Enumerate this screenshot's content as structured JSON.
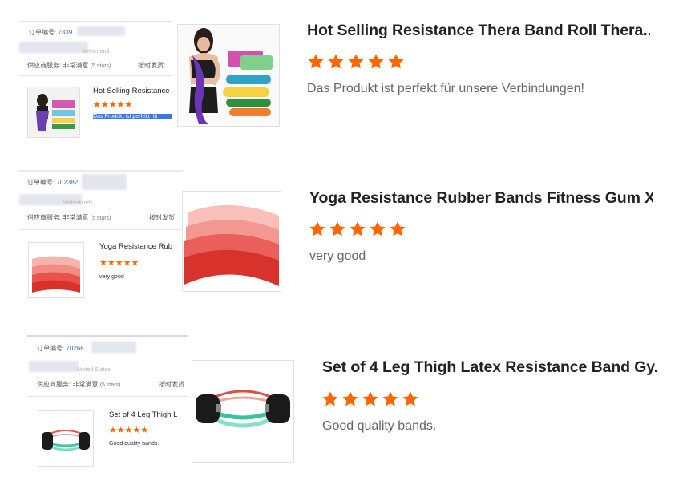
{
  "reviews": [
    {
      "order_label": "订单编号:",
      "order_number_partial": "7339",
      "country": "Netherland",
      "supplier_label": "供应商服务: 非常满意",
      "supplier_stars": "(5 stars)",
      "ontime_label": "按时发货:",
      "mini_title": "Hot Selling Resistance",
      "mini_comment": "Das Produkt ist perfekt für",
      "product_title": "Hot Selling Resistance Thera Band Roll Thera...",
      "rating": 5,
      "comment": "Das Produkt ist perfekt für unsere Verbindungen!",
      "star_color": "#ff6600"
    },
    {
      "order_label": "订单编号:",
      "order_number_partial": "702382",
      "country": "Netherlands",
      "supplier_label": "供应商服务: 非常满意",
      "supplier_stars": "(5 stars)",
      "ontime_label": "按时发货",
      "mini_title": "Yoga Resistance Rub",
      "mini_comment": "very good",
      "product_title": "Yoga Resistance Rubber Bands Fitness Gum X...",
      "rating": 5,
      "comment": "very good",
      "star_color": "#ff6600"
    },
    {
      "order_label": "订单编号:",
      "order_number_partial": "70266",
      "country": "United States",
      "supplier_label": "供应商服务: 非常满意",
      "supplier_stars": "(5 stars)",
      "ontime_label": "按时发货",
      "mini_title": "Set of 4 Leg Thigh L",
      "mini_comment": "Good quality bands.",
      "product_title": "Set of 4 Leg Thigh Latex Resistance Band Gy...",
      "rating": 5,
      "comment": "Good quality bands.",
      "star_color": "#ff6600"
    }
  ],
  "mini_stars_glyph": "★★★★★"
}
